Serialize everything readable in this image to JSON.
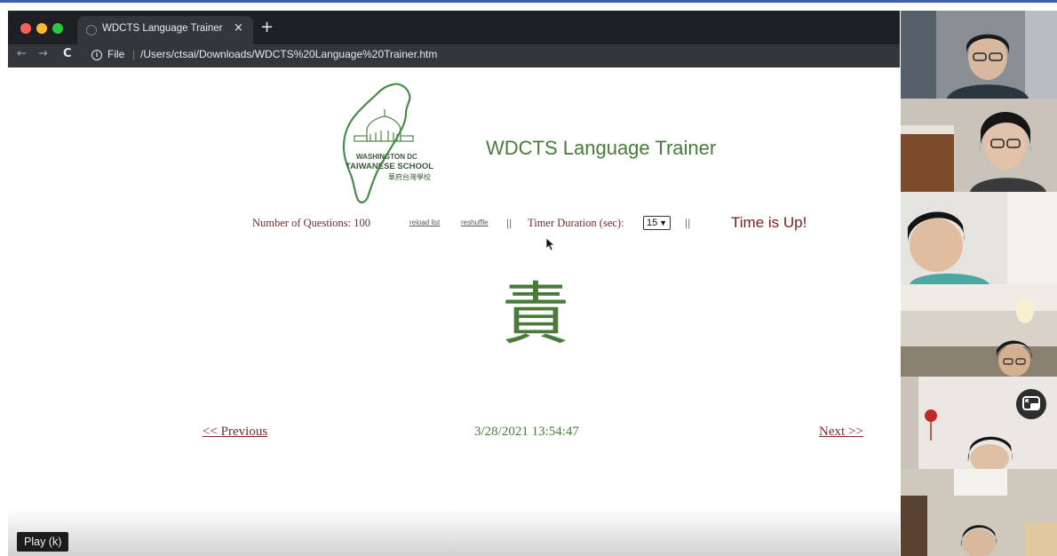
{
  "browser": {
    "tab_title": "WDCTS Language Trainer",
    "tab_close": "×",
    "new_tab": "+",
    "nav_back": "←",
    "nav_forward": "→",
    "nav_reload": "C",
    "info_icon": "i",
    "address_scheme": "File",
    "address_separator": "|",
    "url": "/Users/ctsai/Downloads/WDCTS%20Language%20Trainer.htm"
  },
  "page": {
    "title": "WDCTS Language Trainer",
    "logo": {
      "line1": "WASHINGTON DC",
      "line2": "TAIWANESE SCHOOL",
      "line3": "華府台灣學校",
      "color": "#4a8a4a"
    },
    "controls": {
      "question_count_label": "Number of Questions: 100",
      "reload_list": "reload list",
      "reshuffle": "reshuffle",
      "separator": "||",
      "timer_label": "Timer Duration (sec):",
      "timer_value": "15",
      "status": "Time is Up!"
    },
    "character": "責",
    "navigation": {
      "previous": "<< Previous",
      "datetime": "3/28/2021 13:54:47",
      "next": "Next >>"
    }
  },
  "player": {
    "tooltip": "Play (k)"
  },
  "colors": {
    "accent_green": "#4a7a3a",
    "label_maroon": "#7a2a2a",
    "status_red": "#7a2020",
    "chrome_dark": "#1f2023",
    "top_rule": "#3b5fa8"
  }
}
